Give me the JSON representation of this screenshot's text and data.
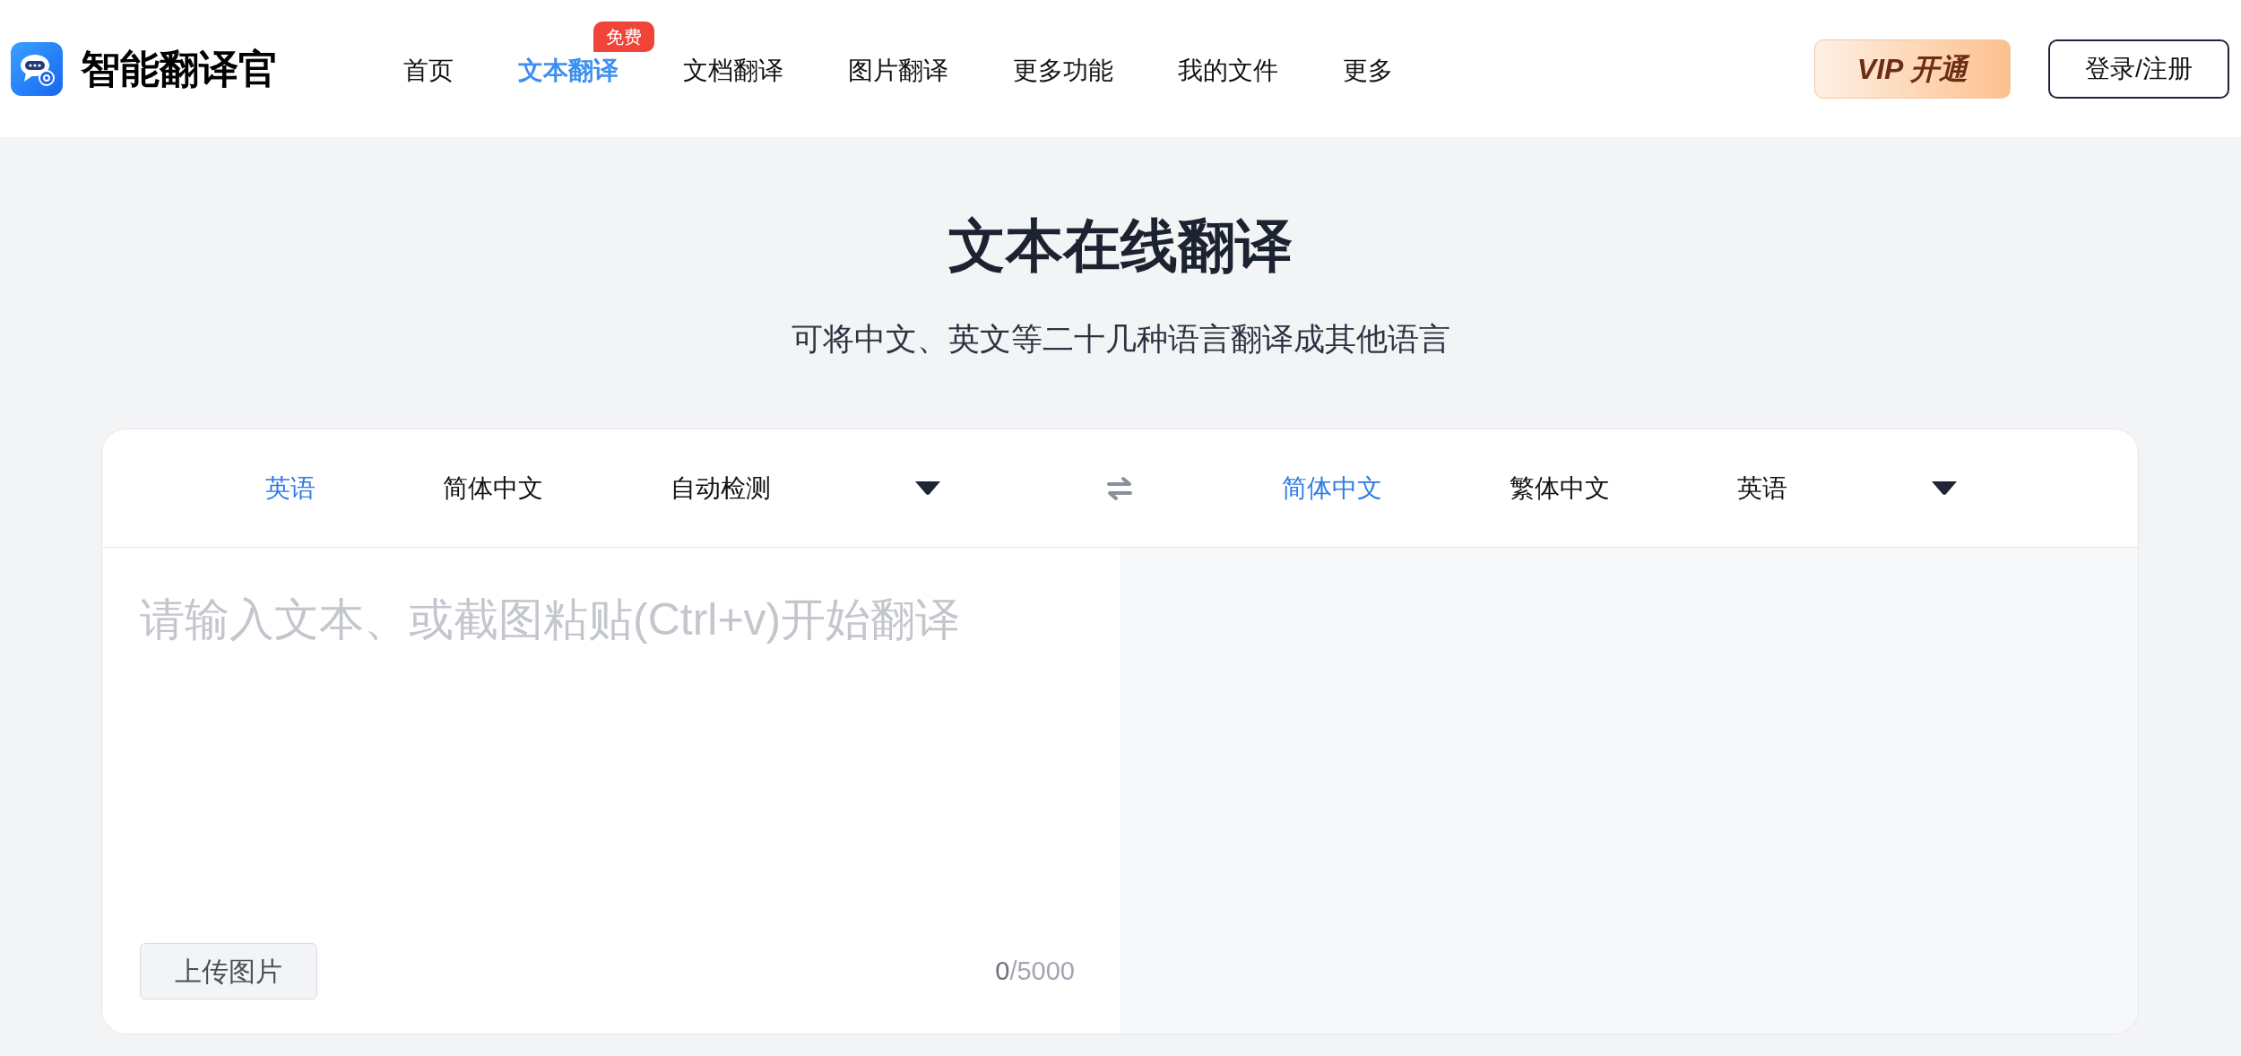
{
  "header": {
    "brand": "智能翻译官",
    "nav": [
      {
        "label": "首页",
        "selected": false
      },
      {
        "label": "文本翻译",
        "selected": true,
        "badge": "免费"
      },
      {
        "label": "文档翻译",
        "selected": false
      },
      {
        "label": "图片翻译",
        "selected": false
      },
      {
        "label": "更多功能",
        "selected": false
      },
      {
        "label": "我的文件",
        "selected": false
      },
      {
        "label": "更多",
        "selected": false
      }
    ],
    "vip_button": "VIP 开通",
    "login_button": "登录/注册"
  },
  "page_title": "文本在线翻译",
  "subtitle": "可将中文、英文等二十几种语言翻译成其他语言",
  "translator": {
    "source_languages": [
      {
        "label": "英语",
        "selected": true
      },
      {
        "label": "简体中文",
        "selected": false
      },
      {
        "label": "自动检测",
        "selected": false
      }
    ],
    "target_languages": [
      {
        "label": "简体中文",
        "selected": true
      },
      {
        "label": "繁体中文",
        "selected": false
      },
      {
        "label": "英语",
        "selected": false
      }
    ],
    "input": {
      "placeholder": "请输入文本、或截图粘贴(Ctrl+v)开始翻译"
    },
    "upload_button": "上传图片",
    "count": "0",
    "limit": "/5000"
  }
}
